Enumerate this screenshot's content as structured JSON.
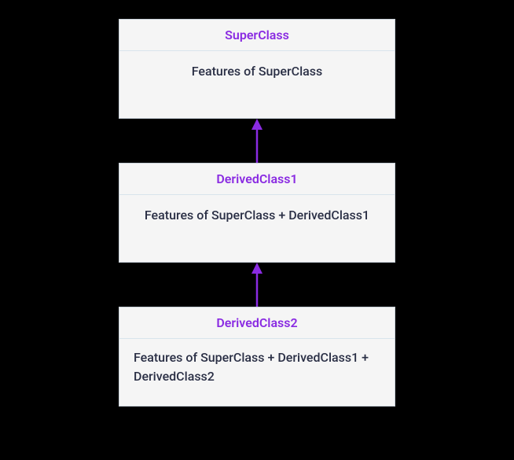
{
  "diagram": {
    "classes": [
      {
        "name": "SuperClass",
        "features": "Features of SuperClass"
      },
      {
        "name": "DerivedClass1",
        "features": "Features of SuperClass + DerivedClass1"
      },
      {
        "name": "DerivedClass2",
        "features": "Features of SuperClass + DerivedClass1 + DerivedClass2"
      }
    ],
    "arrow_color": "#8a2be2"
  }
}
